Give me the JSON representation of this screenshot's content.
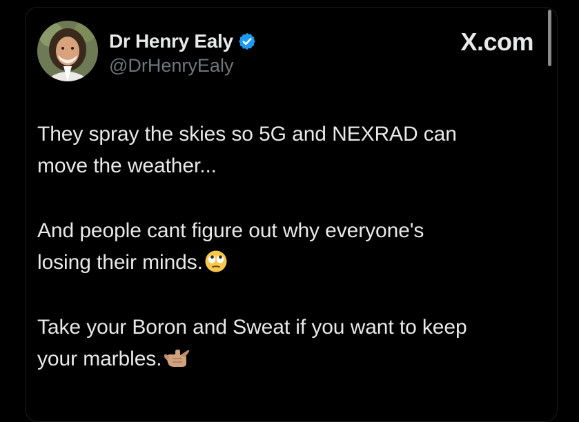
{
  "post": {
    "author": {
      "name": "Dr Henry Ealy",
      "handle": "@DrHenryEaly",
      "verified": true,
      "verified_color": "#1d9bf0"
    },
    "brand": "X.com",
    "paragraphs": [
      {
        "lines": [
          "They spray the skies so 5G and NEXRAD can",
          "move the weather..."
        ]
      },
      {
        "lines": [
          "And people cant figure out why everyone's",
          "losing their minds."
        ],
        "emoji": "face-with-rolling-eyes-icon"
      },
      {
        "lines": [
          "Take your Boron and Sweat if you want to keep",
          "your marbles."
        ],
        "emoji": "call-me-hand-icon"
      }
    ]
  },
  "colors": {
    "background": "#000000",
    "text": "#e7e9ea",
    "secondary_text": "#71767b"
  }
}
